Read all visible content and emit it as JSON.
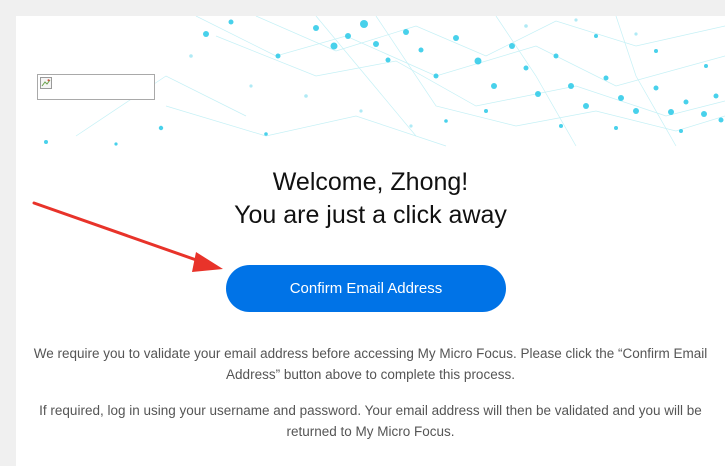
{
  "hero": {
    "accent_color": "#1ec6e6",
    "logo_icon": "broken-image-icon"
  },
  "welcome": {
    "line1": "Welcome, Zhong!",
    "line2": "You are just a click away"
  },
  "cta": {
    "label": "Confirm Email Address",
    "color": "#0073e7"
  },
  "body": {
    "para1": "We require you to validate your email address before accessing My Micro Focus. Please click the “Confirm Email Address” button above to complete this process.",
    "para2": "If required, log in using your username and password. Your email address will then be validated and you will be returned to My Micro Focus."
  },
  "annotation": {
    "arrow_color": "#e8332a"
  }
}
